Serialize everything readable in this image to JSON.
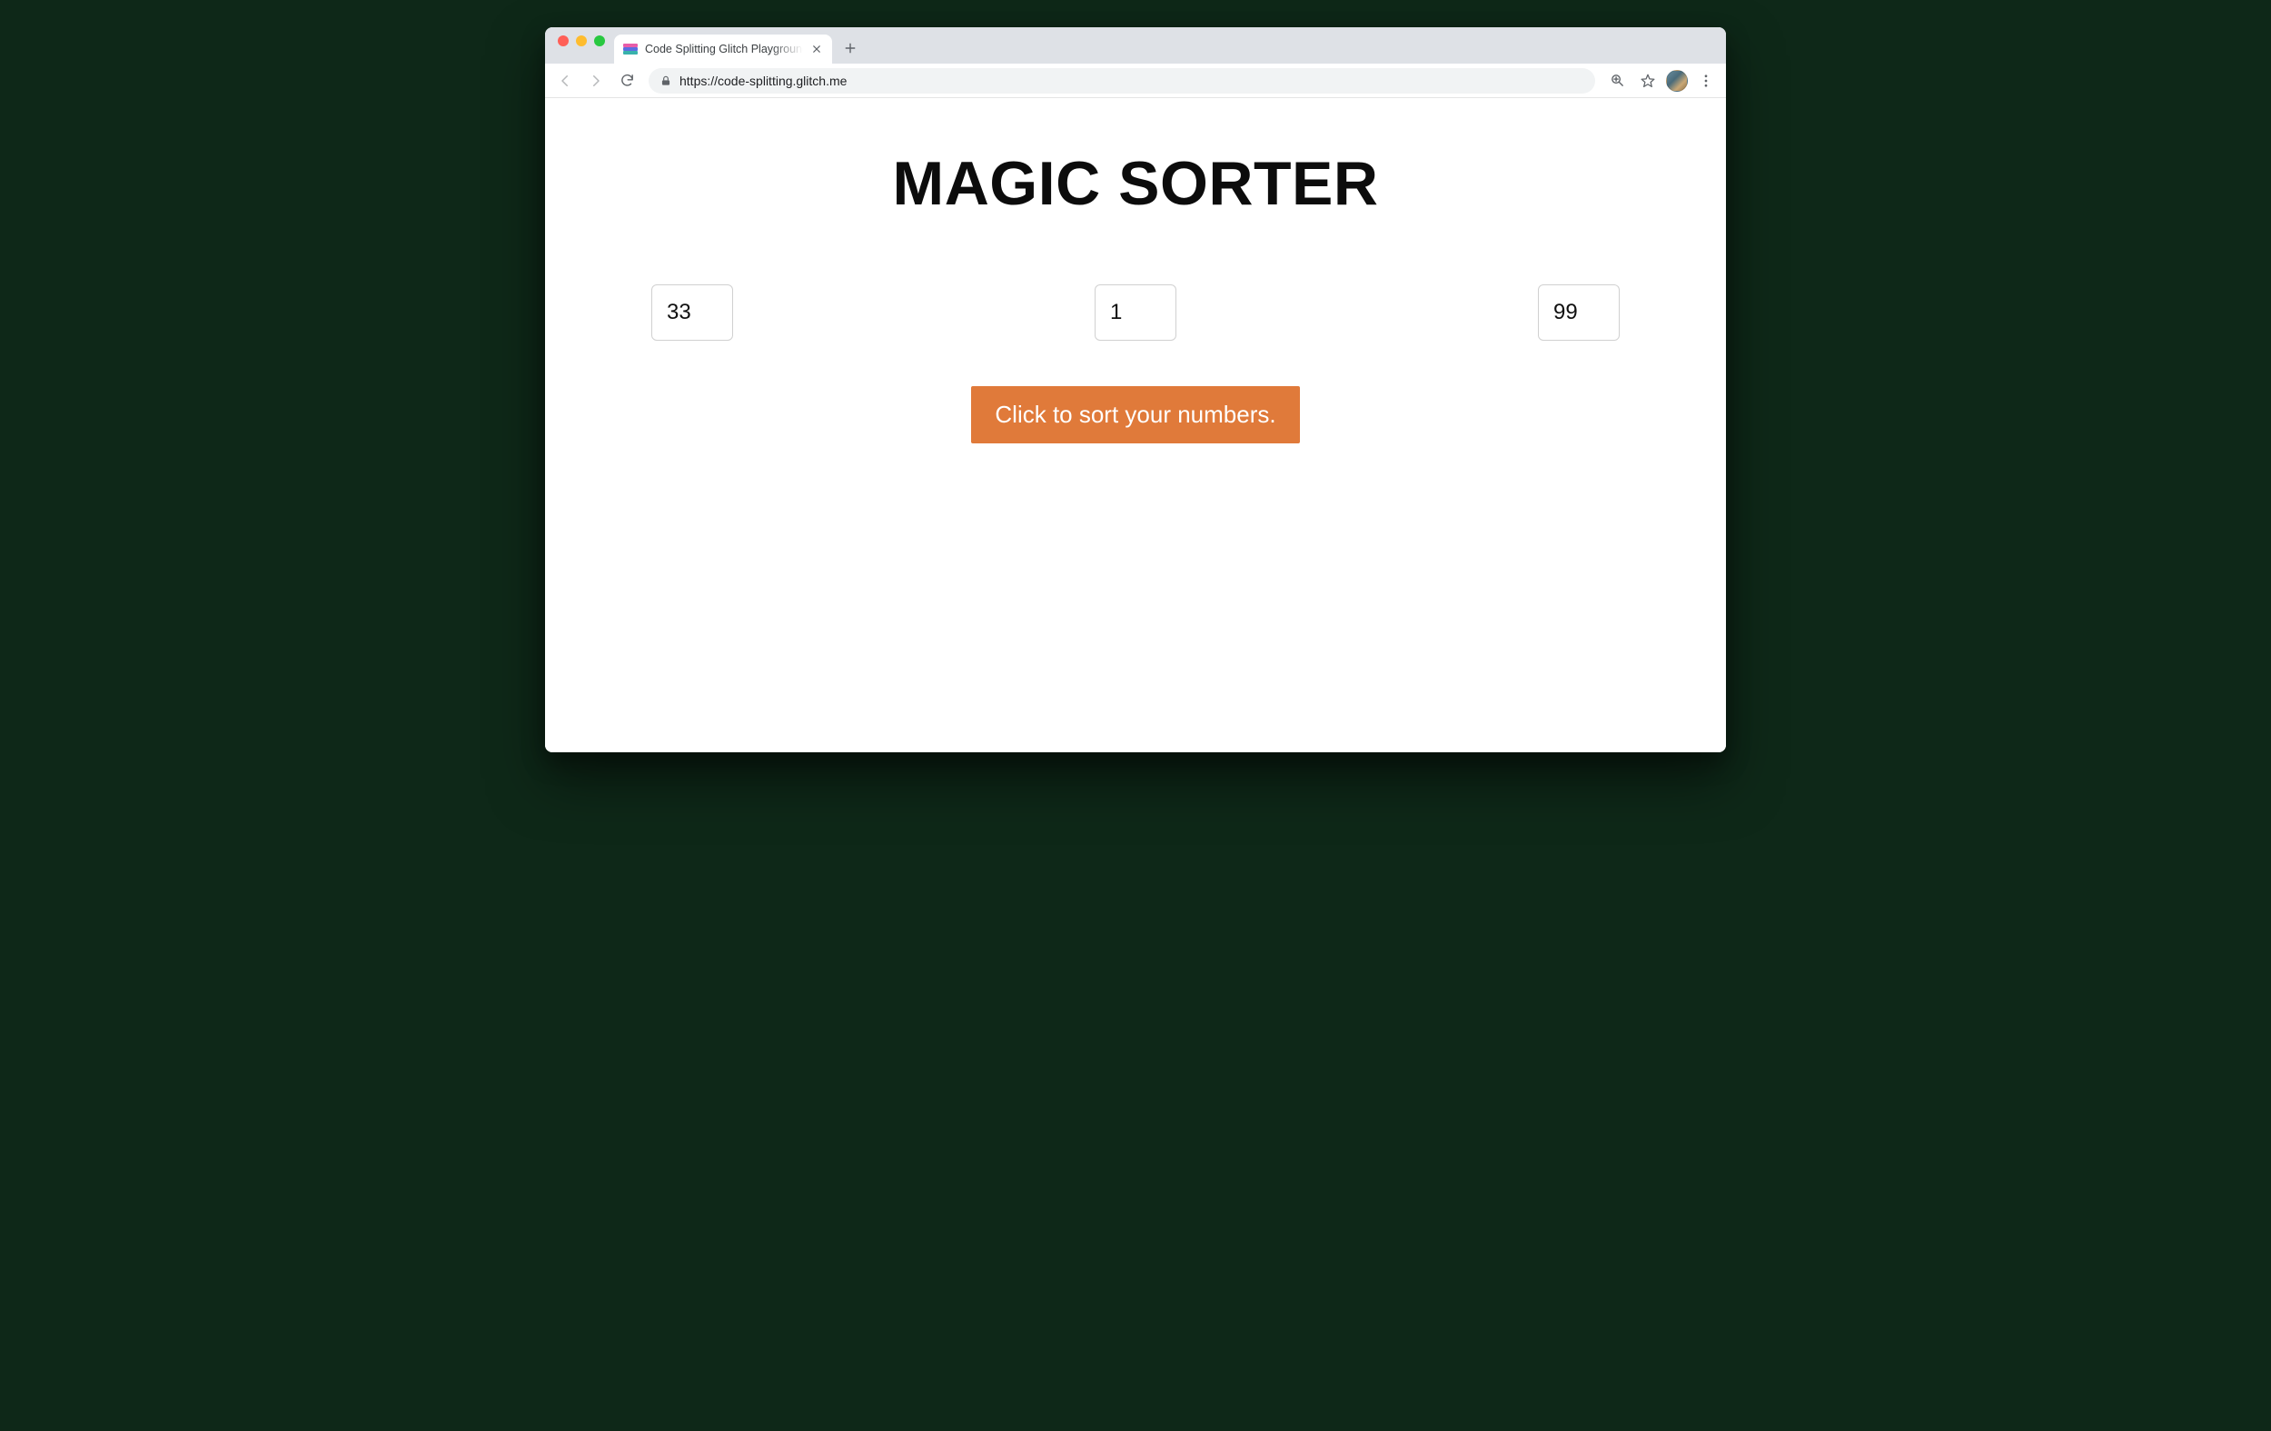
{
  "browser": {
    "tab_title": "Code Splitting Glitch Playground",
    "url": "https://code-splitting.glitch.me"
  },
  "page": {
    "title": "MAGIC SORTER",
    "inputs": [
      "33",
      "1",
      "99"
    ],
    "sort_button_label": "Click to sort your numbers."
  },
  "colors": {
    "accent": "#e07a3a"
  }
}
